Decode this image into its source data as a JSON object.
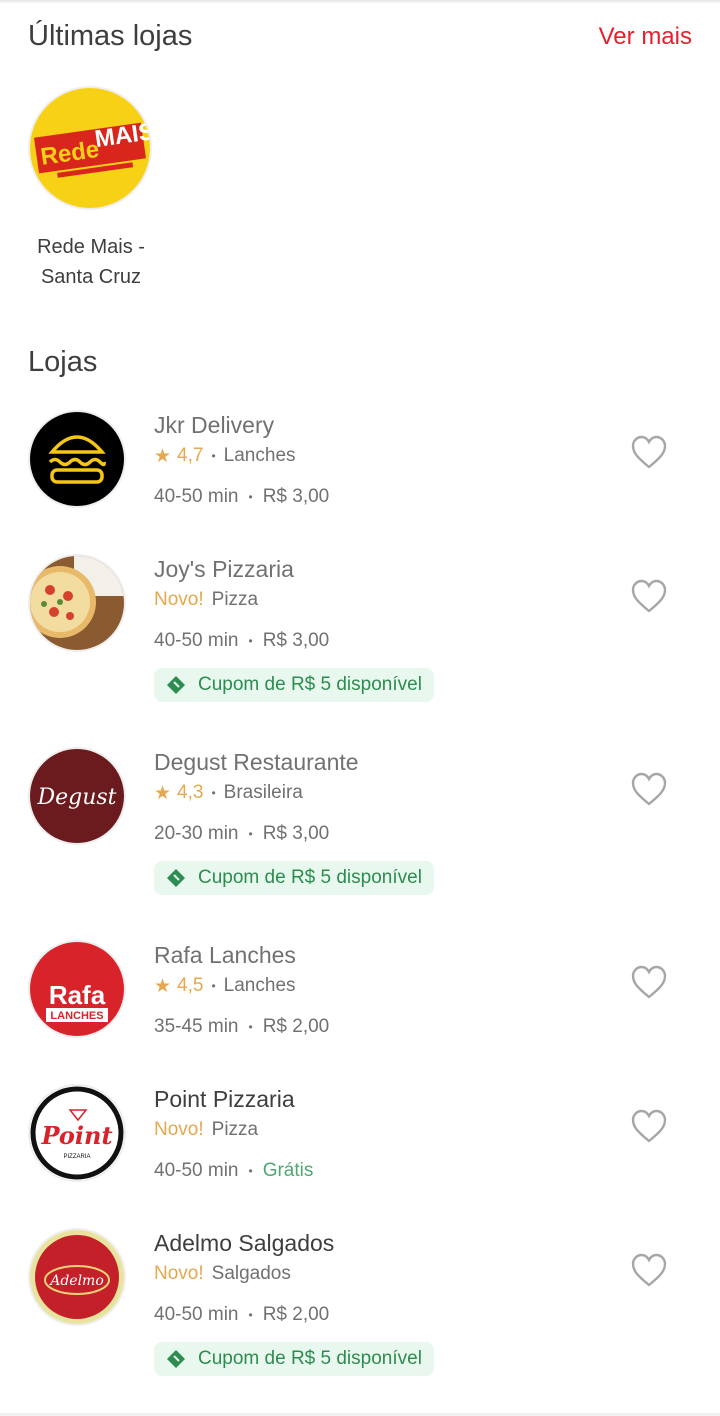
{
  "recent": {
    "title": "Últimas lojas",
    "see_more": "Ver mais",
    "stores": [
      {
        "name_line1": "Rede Mais -",
        "name_line2": "Santa Cruz",
        "logo_text_1": "Rede",
        "logo_text_2": "MAIS"
      }
    ]
  },
  "stores_section": {
    "title": "Lojas",
    "items": [
      {
        "name": "Jkr Delivery",
        "rating": "4,7",
        "category": "Lanches",
        "time": "40-50 min",
        "fee": "R$ 3,00"
      },
      {
        "name": "Joy's Pizzaria",
        "badge": "Novo!",
        "category": "Pizza",
        "time": "40-50 min",
        "fee": "R$ 3,00",
        "coupon": "Cupom de R$ 5 disponível"
      },
      {
        "name": "Degust Restaurante",
        "rating": "4,3",
        "category": "Brasileira",
        "time": "20-30 min",
        "fee": "R$ 3,00",
        "coupon": "Cupom de R$ 5 disponível",
        "logo_text": "Degust"
      },
      {
        "name": "Rafa Lanches",
        "rating": "4,5",
        "category": "Lanches",
        "time": "35-45 min",
        "fee": "R$ 2,00",
        "logo_text_1": "Rafa",
        "logo_text_2": "LANCHES"
      },
      {
        "name": "Point Pizzaria",
        "badge": "Novo!",
        "category": "Pizza",
        "time": "40-50 min",
        "fee": "Grátis",
        "logo_text": "Point",
        "logo_subtext": "PIZZARIA"
      },
      {
        "name": "Adelmo Salgados",
        "badge": "Novo!",
        "category": "Salgados",
        "time": "40-50 min",
        "fee": "R$ 2,00",
        "coupon": "Cupom de R$ 5 disponível",
        "logo_text": "Adelmo"
      }
    ]
  },
  "icons": {
    "rating": "star-icon",
    "favorite": "heart-outline-icon",
    "coupon": "ticket-icon"
  },
  "colors": {
    "accent": "#ea1d2c",
    "rating": "#e7a74e",
    "coupon_text": "#2d8c4f",
    "coupon_bg": "#e8f8ee",
    "free": "#50a773"
  }
}
